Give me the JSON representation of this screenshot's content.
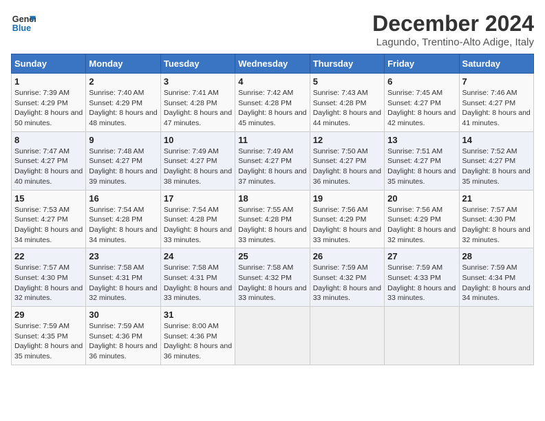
{
  "header": {
    "logo_line1": "General",
    "logo_line2": "Blue",
    "title": "December 2024",
    "subtitle": "Lagundo, Trentino-Alto Adige, Italy"
  },
  "weekdays": [
    "Sunday",
    "Monday",
    "Tuesday",
    "Wednesday",
    "Thursday",
    "Friday",
    "Saturday"
  ],
  "weeks": [
    [
      {
        "day": "1",
        "sunrise": "Sunrise: 7:39 AM",
        "sunset": "Sunset: 4:29 PM",
        "daylight": "Daylight: 8 hours and 50 minutes."
      },
      {
        "day": "2",
        "sunrise": "Sunrise: 7:40 AM",
        "sunset": "Sunset: 4:29 PM",
        "daylight": "Daylight: 8 hours and 48 minutes."
      },
      {
        "day": "3",
        "sunrise": "Sunrise: 7:41 AM",
        "sunset": "Sunset: 4:28 PM",
        "daylight": "Daylight: 8 hours and 47 minutes."
      },
      {
        "day": "4",
        "sunrise": "Sunrise: 7:42 AM",
        "sunset": "Sunset: 4:28 PM",
        "daylight": "Daylight: 8 hours and 45 minutes."
      },
      {
        "day": "5",
        "sunrise": "Sunrise: 7:43 AM",
        "sunset": "Sunset: 4:28 PM",
        "daylight": "Daylight: 8 hours and 44 minutes."
      },
      {
        "day": "6",
        "sunrise": "Sunrise: 7:45 AM",
        "sunset": "Sunset: 4:27 PM",
        "daylight": "Daylight: 8 hours and 42 minutes."
      },
      {
        "day": "7",
        "sunrise": "Sunrise: 7:46 AM",
        "sunset": "Sunset: 4:27 PM",
        "daylight": "Daylight: 8 hours and 41 minutes."
      }
    ],
    [
      {
        "day": "8",
        "sunrise": "Sunrise: 7:47 AM",
        "sunset": "Sunset: 4:27 PM",
        "daylight": "Daylight: 8 hours and 40 minutes."
      },
      {
        "day": "9",
        "sunrise": "Sunrise: 7:48 AM",
        "sunset": "Sunset: 4:27 PM",
        "daylight": "Daylight: 8 hours and 39 minutes."
      },
      {
        "day": "10",
        "sunrise": "Sunrise: 7:49 AM",
        "sunset": "Sunset: 4:27 PM",
        "daylight": "Daylight: 8 hours and 38 minutes."
      },
      {
        "day": "11",
        "sunrise": "Sunrise: 7:49 AM",
        "sunset": "Sunset: 4:27 PM",
        "daylight": "Daylight: 8 hours and 37 minutes."
      },
      {
        "day": "12",
        "sunrise": "Sunrise: 7:50 AM",
        "sunset": "Sunset: 4:27 PM",
        "daylight": "Daylight: 8 hours and 36 minutes."
      },
      {
        "day": "13",
        "sunrise": "Sunrise: 7:51 AM",
        "sunset": "Sunset: 4:27 PM",
        "daylight": "Daylight: 8 hours and 35 minutes."
      },
      {
        "day": "14",
        "sunrise": "Sunrise: 7:52 AM",
        "sunset": "Sunset: 4:27 PM",
        "daylight": "Daylight: 8 hours and 35 minutes."
      }
    ],
    [
      {
        "day": "15",
        "sunrise": "Sunrise: 7:53 AM",
        "sunset": "Sunset: 4:27 PM",
        "daylight": "Daylight: 8 hours and 34 minutes."
      },
      {
        "day": "16",
        "sunrise": "Sunrise: 7:54 AM",
        "sunset": "Sunset: 4:28 PM",
        "daylight": "Daylight: 8 hours and 34 minutes."
      },
      {
        "day": "17",
        "sunrise": "Sunrise: 7:54 AM",
        "sunset": "Sunset: 4:28 PM",
        "daylight": "Daylight: 8 hours and 33 minutes."
      },
      {
        "day": "18",
        "sunrise": "Sunrise: 7:55 AM",
        "sunset": "Sunset: 4:28 PM",
        "daylight": "Daylight: 8 hours and 33 minutes."
      },
      {
        "day": "19",
        "sunrise": "Sunrise: 7:56 AM",
        "sunset": "Sunset: 4:29 PM",
        "daylight": "Daylight: 8 hours and 33 minutes."
      },
      {
        "day": "20",
        "sunrise": "Sunrise: 7:56 AM",
        "sunset": "Sunset: 4:29 PM",
        "daylight": "Daylight: 8 hours and 32 minutes."
      },
      {
        "day": "21",
        "sunrise": "Sunrise: 7:57 AM",
        "sunset": "Sunset: 4:30 PM",
        "daylight": "Daylight: 8 hours and 32 minutes."
      }
    ],
    [
      {
        "day": "22",
        "sunrise": "Sunrise: 7:57 AM",
        "sunset": "Sunset: 4:30 PM",
        "daylight": "Daylight: 8 hours and 32 minutes."
      },
      {
        "day": "23",
        "sunrise": "Sunrise: 7:58 AM",
        "sunset": "Sunset: 4:31 PM",
        "daylight": "Daylight: 8 hours and 32 minutes."
      },
      {
        "day": "24",
        "sunrise": "Sunrise: 7:58 AM",
        "sunset": "Sunset: 4:31 PM",
        "daylight": "Daylight: 8 hours and 33 minutes."
      },
      {
        "day": "25",
        "sunrise": "Sunrise: 7:58 AM",
        "sunset": "Sunset: 4:32 PM",
        "daylight": "Daylight: 8 hours and 33 minutes."
      },
      {
        "day": "26",
        "sunrise": "Sunrise: 7:59 AM",
        "sunset": "Sunset: 4:32 PM",
        "daylight": "Daylight: 8 hours and 33 minutes."
      },
      {
        "day": "27",
        "sunrise": "Sunrise: 7:59 AM",
        "sunset": "Sunset: 4:33 PM",
        "daylight": "Daylight: 8 hours and 33 minutes."
      },
      {
        "day": "28",
        "sunrise": "Sunrise: 7:59 AM",
        "sunset": "Sunset: 4:34 PM",
        "daylight": "Daylight: 8 hours and 34 minutes."
      }
    ],
    [
      {
        "day": "29",
        "sunrise": "Sunrise: 7:59 AM",
        "sunset": "Sunset: 4:35 PM",
        "daylight": "Daylight: 8 hours and 35 minutes."
      },
      {
        "day": "30",
        "sunrise": "Sunrise: 7:59 AM",
        "sunset": "Sunset: 4:36 PM",
        "daylight": "Daylight: 8 hours and 36 minutes."
      },
      {
        "day": "31",
        "sunrise": "Sunrise: 8:00 AM",
        "sunset": "Sunset: 4:36 PM",
        "daylight": "Daylight: 8 hours and 36 minutes."
      },
      null,
      null,
      null,
      null
    ]
  ]
}
